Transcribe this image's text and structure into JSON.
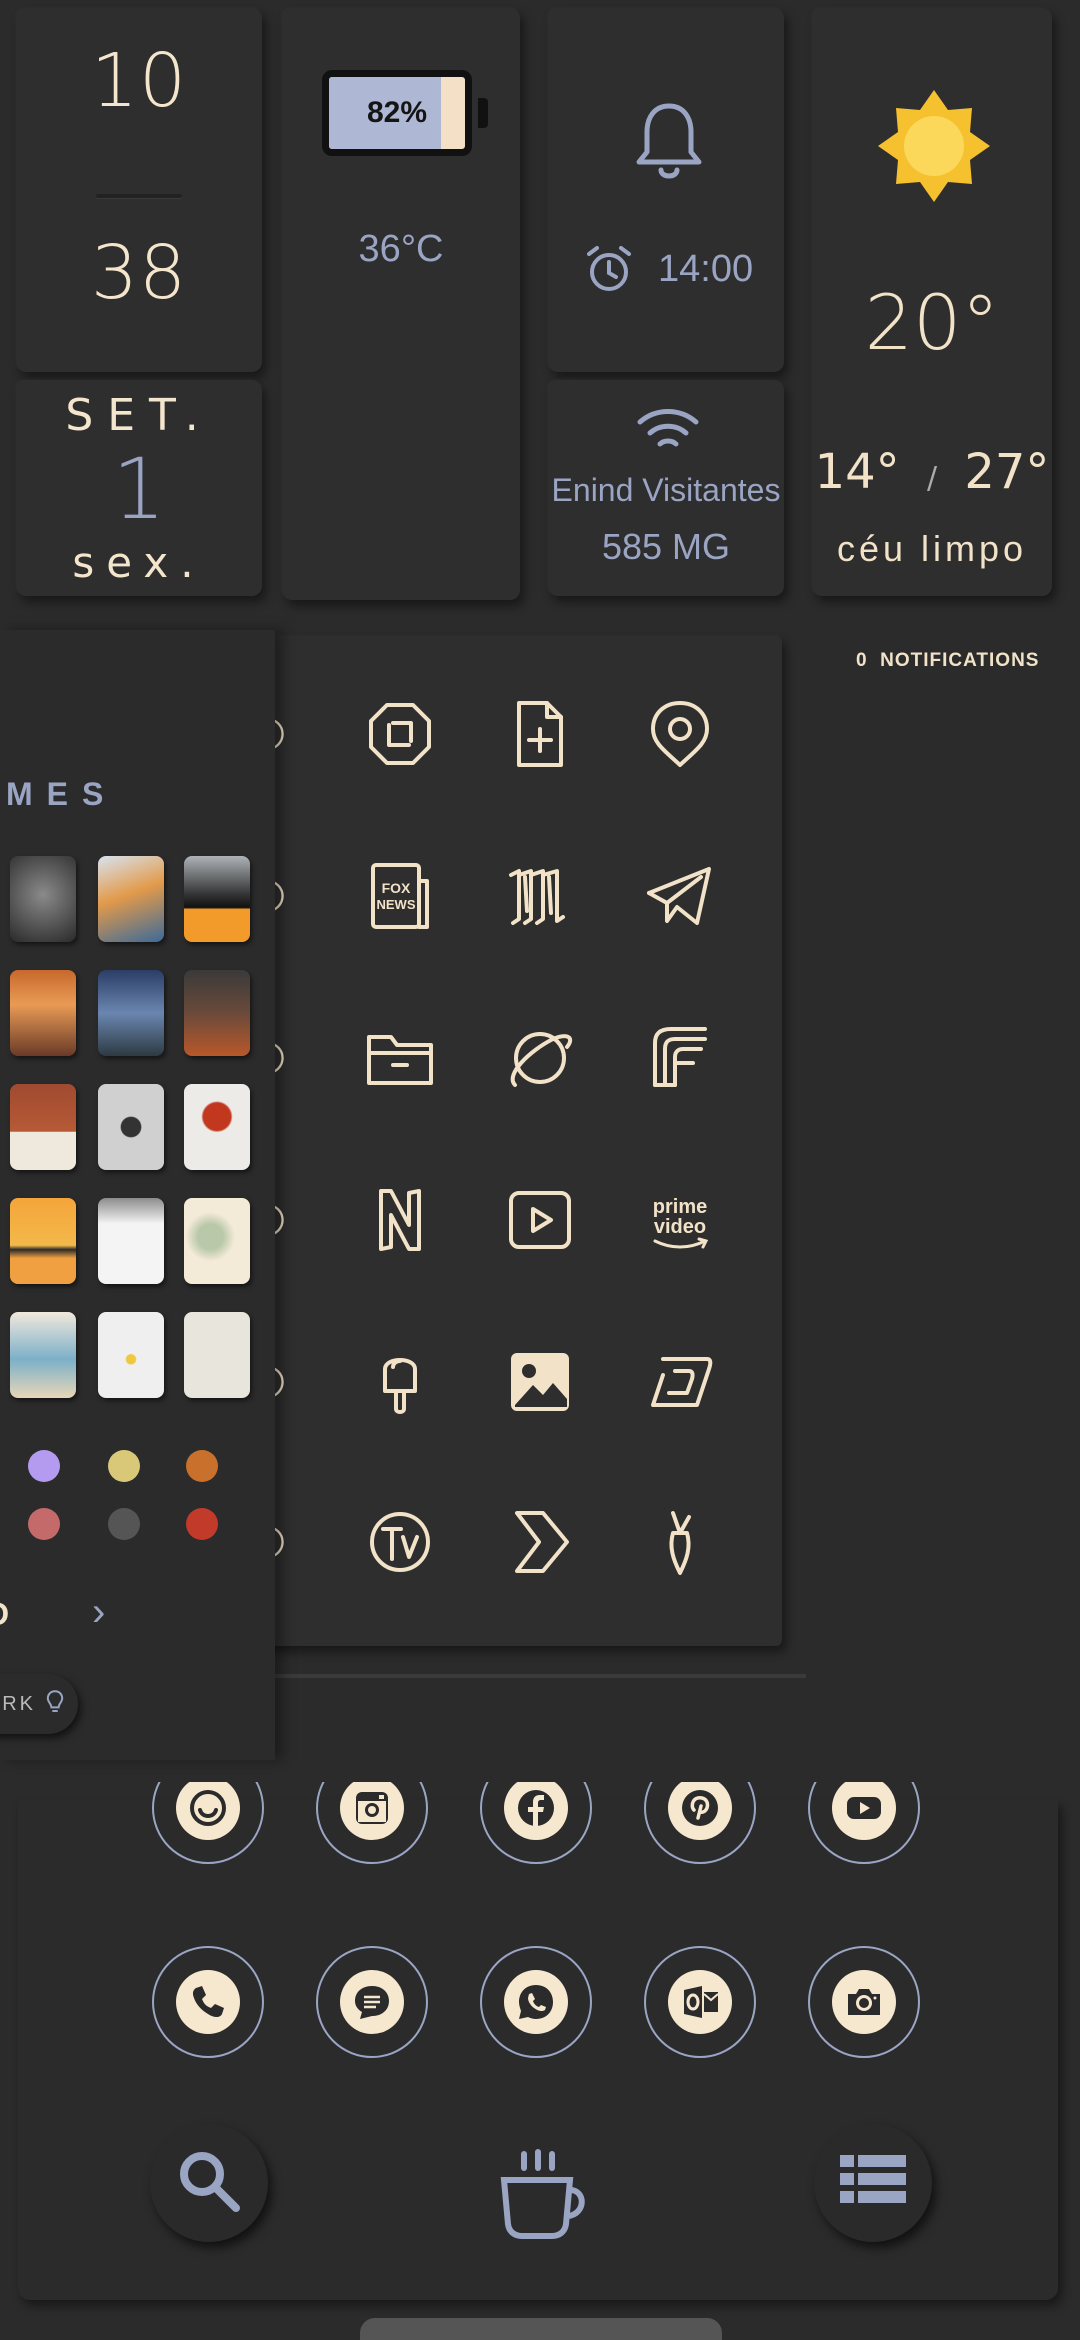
{
  "clock": {
    "hour": "10",
    "minute": "38"
  },
  "date": {
    "month": "SET.",
    "day": "1",
    "weekday": "sex."
  },
  "battery": {
    "percent_label": "82%",
    "level": 0.82,
    "temperature": "36°C"
  },
  "alarm": {
    "time": "14:00"
  },
  "wifi": {
    "network": "Enind Visitantes",
    "usage": "585 MG"
  },
  "weather": {
    "temp": "20°",
    "low": "14°",
    "separator": "/",
    "high": "27°",
    "condition": "céu limpo"
  },
  "notifications": {
    "label": "0  NOTIFICATIONS"
  },
  "themes": {
    "title": "MES",
    "more_text": "D",
    "chevron": "›",
    "dark_label": "RK"
  },
  "colors": {
    "background": "#2b2b2b",
    "card": "#2e2e2e",
    "cream": "#f1e2c8",
    "accent_blue": "#9aa5c4",
    "sun": "#f7c83a",
    "dots": [
      "#b59bf0",
      "#d8c878",
      "#c8702c",
      "#c46a6a",
      "#555555",
      "#c23a2a"
    ]
  },
  "grid_icons": [
    [
      "partial-icon",
      "sync-square-icon",
      "file-add-icon",
      "location-pin-icon"
    ],
    [
      "partial-icon",
      "fox-news-icon",
      "old-english-m-icon",
      "telegram-icon"
    ],
    [
      "partial-icon",
      "folder-icon",
      "planet-icon",
      "feedly-icon"
    ],
    [
      "partial-icon",
      "netflix-n-icon",
      "video-play-icon",
      "prime-video-icon"
    ],
    [
      "partial-icon",
      "popsicle-icon",
      "gallery-icon",
      "deezer-icon"
    ],
    [
      "partial-icon",
      "tv-icon",
      "chevron-app-icon",
      "carrot-icon"
    ]
  ],
  "prime_video_text": {
    "line1": "prime",
    "line2": "video"
  },
  "fox_text": {
    "line1": "FOX",
    "line2": "NEWS"
  },
  "dock_row1": [
    "smile-app-icon",
    "instagram-icon",
    "facebook-icon",
    "pinterest-icon",
    "youtube-icon"
  ],
  "dock_row2": [
    "phone-icon",
    "messages-icon",
    "whatsapp-icon",
    "outlook-icon",
    "camera-icon"
  ],
  "bottom_bar": [
    "search-icon",
    "coffee-cup-icon",
    "list-icon"
  ]
}
